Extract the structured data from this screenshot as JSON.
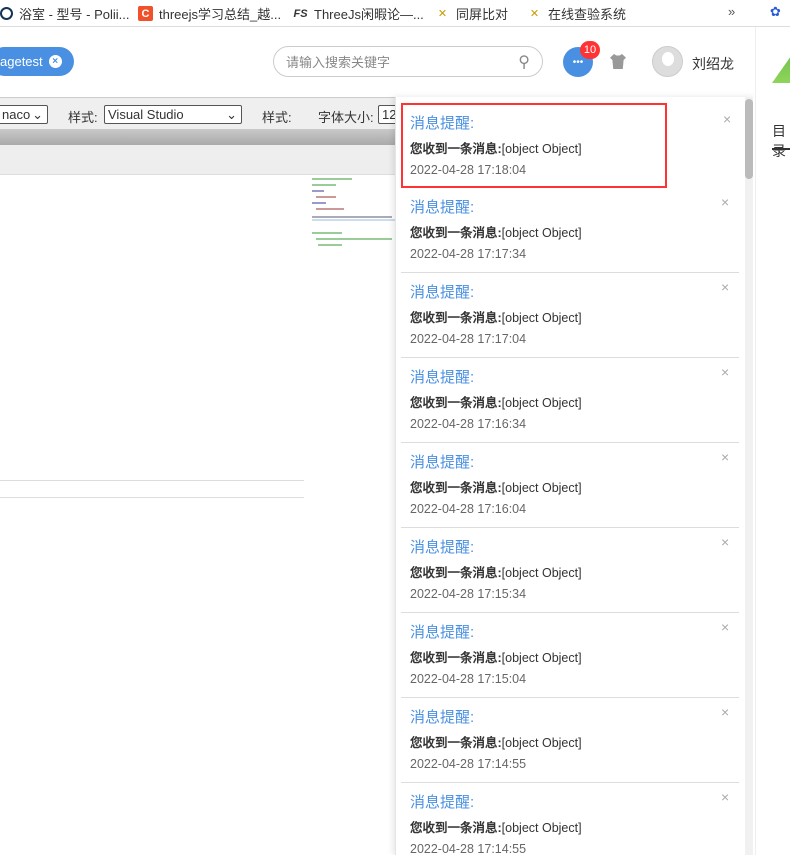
{
  "bookmarks": [
    {
      "label": "浴室 - 型号 - Polii...",
      "icon": "hex-icon"
    },
    {
      "label": "threejs学习总结_越...",
      "icon": "c-icon"
    },
    {
      "label": "ThreeJs闲暇论—...",
      "icon": "fs-icon"
    },
    {
      "label": "同屏比对",
      "icon": "tools-icon"
    },
    {
      "label": "在线查验系统",
      "icon": "tools-icon"
    }
  ],
  "bookmarks_more": "»",
  "header": {
    "tag": "agetest",
    "search_placeholder": "请输入搜索关键字",
    "badge": "10",
    "username": "刘绍龙"
  },
  "toolbar": {
    "theme_value": "naco",
    "style_label": "样式:",
    "style_value": "Visual Studio",
    "style2_label": "样式:",
    "font_label": "字体大小:",
    "font_value": "12"
  },
  "side": {
    "label": "目录"
  },
  "notifications": [
    {
      "title": "消息提醒:",
      "body_label": "您收到一条消息:",
      "body": "[object Object]",
      "time": "2022-04-28 17:18:04"
    },
    {
      "title": "消息提醒:",
      "body_label": "您收到一条消息:",
      "body": "[object Object]",
      "time": "2022-04-28 17:17:34"
    },
    {
      "title": "消息提醒:",
      "body_label": "您收到一条消息:",
      "body": "[object Object]",
      "time": "2022-04-28 17:17:04"
    },
    {
      "title": "消息提醒:",
      "body_label": "您收到一条消息:",
      "body": "[object Object]",
      "time": "2022-04-28 17:16:34"
    },
    {
      "title": "消息提醒:",
      "body_label": "您收到一条消息:",
      "body": "[object Object]",
      "time": "2022-04-28 17:16:04"
    },
    {
      "title": "消息提醒:",
      "body_label": "您收到一条消息:",
      "body": "[object Object]",
      "time": "2022-04-28 17:15:34"
    },
    {
      "title": "消息提醒:",
      "body_label": "您收到一条消息:",
      "body": "[object Object]",
      "time": "2022-04-28 17:15:04"
    },
    {
      "title": "消息提醒:",
      "body_label": "您收到一条消息:",
      "body": "[object Object]",
      "time": "2022-04-28 17:14:55"
    },
    {
      "title": "消息提醒:",
      "body_label": "您收到一条消息:",
      "body": "[object Object]",
      "time": "2022-04-28 17:14:55"
    }
  ],
  "close_glyph": "×"
}
